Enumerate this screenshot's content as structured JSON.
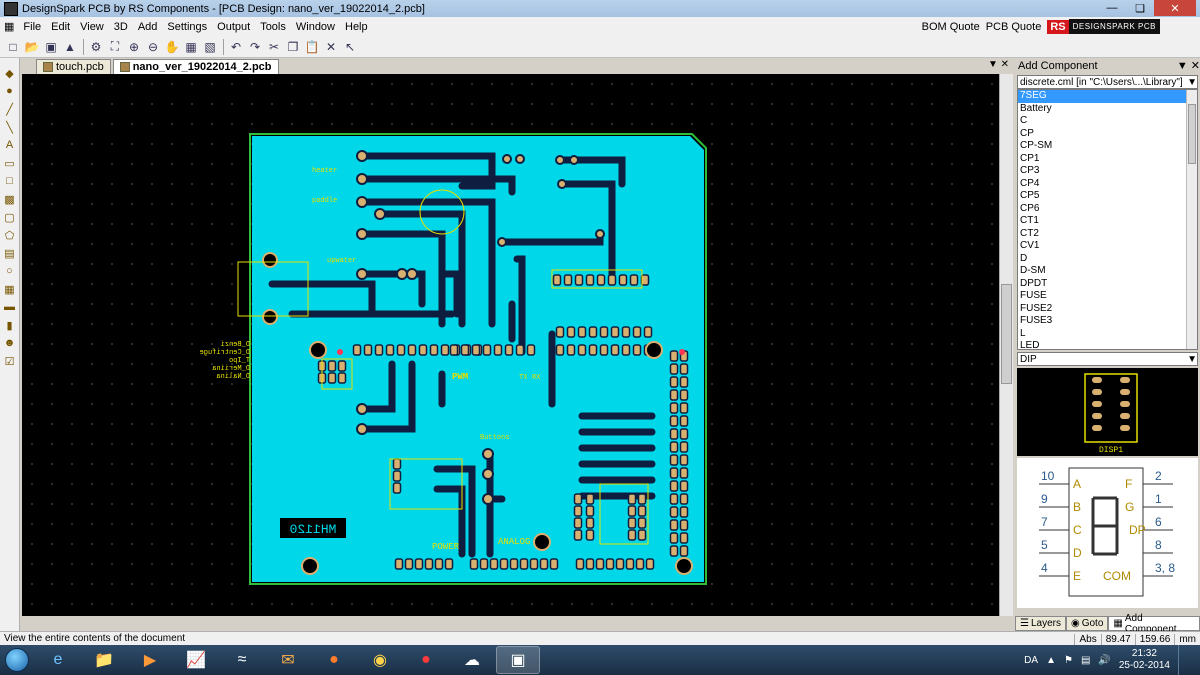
{
  "window": {
    "title": "DesignSpark PCB by RS Components - [PCB Design: nano_ver_19022014_2.pcb]",
    "controls": [
      "minimize",
      "restore",
      "close"
    ]
  },
  "menu": {
    "items": [
      "File",
      "Edit",
      "View",
      "3D",
      "Add",
      "Settings",
      "Output",
      "Tools",
      "Window",
      "Help"
    ],
    "bom_quote": "BOM Quote",
    "pcb_quote": "PCB Quote",
    "logo_rs": "RS",
    "logo_text": "DESIGNSPARK PCB"
  },
  "tabs": [
    {
      "label": "touch.pcb"
    },
    {
      "label": "nano_ver_19022014_2.pcb"
    }
  ],
  "pcb": {
    "board_color": "#00d7e8",
    "outline_color": "#2fbf3a",
    "trace_color": "#0f1e40",
    "silk_color": "#e6e000",
    "labels": {
      "mh_text": "MH1120",
      "buttons": "Buttons",
      "pwm": "PWM",
      "power": "POWER",
      "analog": "ANALOG",
      "upwater": "upwater",
      "paddle": "paddle",
      "heater": "heater",
      "tx": "TX",
      "rx": "RX"
    },
    "left_labels": [
      "D_Benzi",
      "D_Centrifuge",
      "T_Ipo",
      "D_Meriina",
      "D_Nalina"
    ]
  },
  "panel": {
    "title": "Add Component",
    "library": "discrete.cml   [in \"C:\\Users\\...\\Library\"]",
    "components": [
      "7SEG",
      "Battery",
      "C",
      "CP",
      "CP-SM",
      "CP1",
      "CP3",
      "CP4",
      "CP5",
      "CP6",
      "CT1",
      "CT2",
      "CV1",
      "D",
      "D-SM",
      "DPDT",
      "FUSE",
      "FUSE2",
      "FUSE3",
      "L",
      "LED"
    ],
    "selected": "7SEG",
    "footprint": "DIP",
    "footprint_label": "DISP1",
    "schematic": {
      "left_pins": [
        "10",
        "9",
        "7",
        "5",
        "4"
      ],
      "left_letters": [
        "A",
        "B",
        "C",
        "D",
        "E"
      ],
      "right_pins": [
        "2",
        "1",
        "6",
        "8",
        "3, 8"
      ],
      "right_letters": [
        "F",
        "G",
        "DP",
        "COM"
      ]
    },
    "bottom_tabs": [
      "Layers",
      "Goto",
      "Add Component"
    ]
  },
  "status": {
    "message": "View the entire contents of the document",
    "mode": "Abs",
    "x": "89.47",
    "y": "159.66",
    "units": "mm"
  },
  "taskbar": {
    "apps": [
      "internet-explorer",
      "file-explorer",
      "media-player",
      "stock-app",
      "wifi-app",
      "outlook",
      "firefox",
      "chrome",
      "pushpin-app",
      "cloud-app",
      "designspark"
    ],
    "lang": "DA",
    "time": "21:32",
    "date": "25-02-2014"
  },
  "icons": {
    "toolbar": [
      "new-icon",
      "open-icon",
      "save-icon",
      "3d-icon",
      "settings-icon",
      "zoom-fit-icon",
      "zoom-in-icon",
      "zoom-out-icon",
      "pan-icon",
      "grid-icon",
      "undo-icon",
      "redo-icon",
      "cut-icon",
      "copy-icon",
      "paste-icon",
      "delete-icon",
      "select-icon"
    ]
  }
}
